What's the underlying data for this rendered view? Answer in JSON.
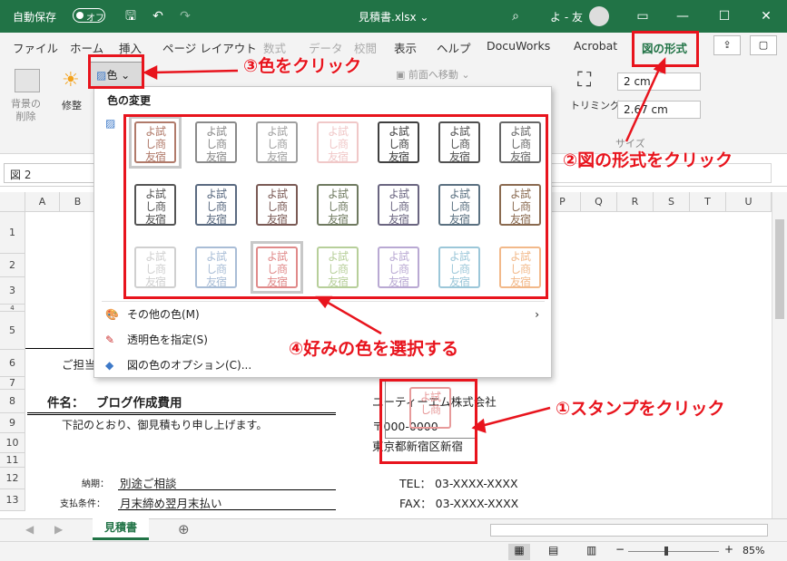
{
  "titlebar": {
    "autosave_label": "自動保存",
    "autosave_state": "オフ",
    "filename": "見積書.xlsx ⌄",
    "user": "よ - 友"
  },
  "tabs": [
    "ファイル",
    "ホーム",
    "挿入",
    "ページ レイアウト",
    "数式",
    "データ",
    "校閲",
    "表示",
    "ヘルプ",
    "DocuWorks",
    "Acrobat",
    "図の形式"
  ],
  "ribbon": {
    "bg_remove": "背景の\n削除",
    "corrections": "修整",
    "color_button": "色",
    "bring_forward": "前面へ移動",
    "crop": "トリミング",
    "height": "2 cm",
    "width": "2.67 cm",
    "size_group": "サイズ"
  },
  "namebox": "図 2",
  "columns": [
    "A",
    "B",
    "P",
    "Q",
    "R",
    "S",
    "T",
    "U"
  ],
  "rows": [
    "1",
    "2",
    "3",
    "4",
    "5",
    "6",
    "7",
    "8",
    "9",
    "10",
    "11",
    "12",
    "13"
  ],
  "cells": {
    "r6": "ご担当",
    "subject_label": "件名：",
    "subject_value": "ブログ作成費用",
    "company": "ユーティーエム株式会社",
    "intro": "下記のとおり、御見積もり申し上げます。",
    "postal": "〒000-0000",
    "address": "東京都新宿区新宿",
    "delivery_label": "納期：",
    "delivery_value": "別途ご相談",
    "tel": "TEL：  03-XXXX-XXXX",
    "payment_label": "支払条件：",
    "payment_value": "月末締め翌月末払い",
    "fax": "FAX：  03-XXXX-XXXX"
  },
  "dropdown": {
    "header": "色の変更",
    "stamp_text": [
      "よ",
      "試",
      "し",
      "商",
      "友",
      "宿"
    ],
    "more_colors": "その他の色(M)",
    "set_transparent": "透明色を指定(S)",
    "color_options": "図の色のオプション(C)..."
  },
  "swatches": [
    [
      "#b07a6a",
      "#8a8a8a",
      "#a0a0a0",
      "#f0c8c8",
      "#404040",
      "#505050",
      "#666666"
    ],
    [
      "#555555",
      "#5a6a80",
      "#7a5a55",
      "#6f7a60",
      "#6a6580",
      "#5a7080",
      "#8a6a50"
    ],
    [
      "#d0d0d0",
      "#a9bdd6",
      "#e08a8a",
      "#b7cf9a",
      "#b9a9d3",
      "#9cc7d9",
      "#f2b98a"
    ]
  ],
  "sheet_tab": "見積書",
  "zoom": "85%",
  "annotations": {
    "a1": "①スタンプをクリック",
    "a2": "②図の形式をクリック",
    "a3": "③色をクリック",
    "a4": "④好みの色を選択する"
  },
  "colors": {
    "excel_green": "#217346",
    "annotation_red": "#e8141d"
  }
}
